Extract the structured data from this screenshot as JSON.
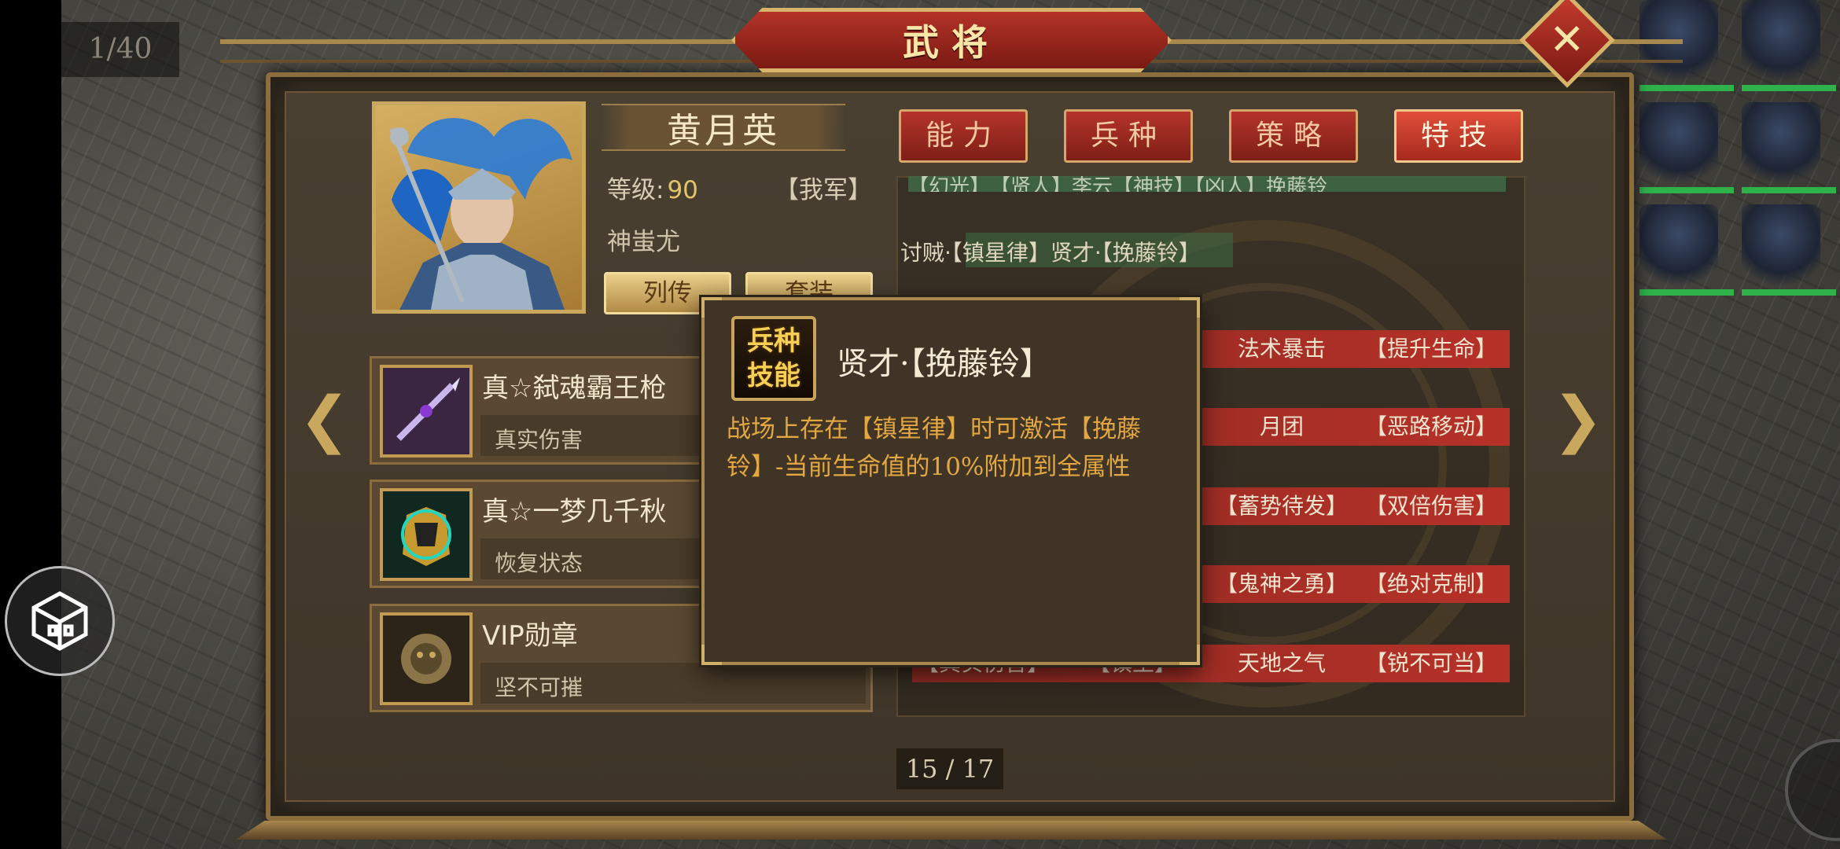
{
  "page_counter": "1/40",
  "window_title": "武将",
  "close_label": "✕",
  "hero": {
    "name": "黄月英",
    "level_label": "等级:",
    "level_value": "90",
    "faction": "【我军】",
    "title": "神蚩尤",
    "btn_biography": "列传",
    "btn_outfit": "套装"
  },
  "equipment": [
    {
      "name": "真☆弑魂霸王枪",
      "desc": "真实伤害",
      "icon": "spear-icon"
    },
    {
      "name": "真☆一梦几千秋",
      "desc": "恢复状态",
      "icon": "armor-icon"
    },
    {
      "name": "VIP勋章",
      "desc": "坚不可摧",
      "icon": "medal-icon"
    }
  ],
  "tabs": [
    {
      "label": "能力",
      "active": false
    },
    {
      "label": "兵种",
      "active": false
    },
    {
      "label": "策略",
      "active": false
    },
    {
      "label": "特技",
      "active": true
    }
  ],
  "skills": {
    "top_partial": "【幻光】　【贤人】李云【神技】【凶人】挽藤铃",
    "line": "讨贼·【镇星律】贤才·【挽藤铃】",
    "rows": [
      {
        "a": "",
        "b": "",
        "c": "法术暴击",
        "d": "【提升生命】"
      },
      {
        "a": "",
        "b": "",
        "c": "月团",
        "d": "【恶路移动】"
      },
      {
        "a": "",
        "b": "",
        "c": "【蓄势待发】",
        "d": "【双倍伤害】"
      },
      {
        "a": "",
        "b": "",
        "c": "【鬼神之勇】",
        "d": "【绝对克制】"
      },
      {
        "a": "【真实伤害】",
        "b": "【镇王】",
        "c": "天地之气",
        "d": "【锐不可当】"
      }
    ]
  },
  "pager": "15 / 17",
  "popup": {
    "badge_line1": "兵种",
    "badge_line2": "技能",
    "title": "贤才·【挽藤铃】",
    "description": "战场上存在【镇星律】时可激活【挽藤铃】-当前生命值的10%附加到全属性"
  },
  "colors": {
    "tab_red": "#b5342a",
    "gold_border": "#c9a75d",
    "popup_text": "#e3a742"
  }
}
